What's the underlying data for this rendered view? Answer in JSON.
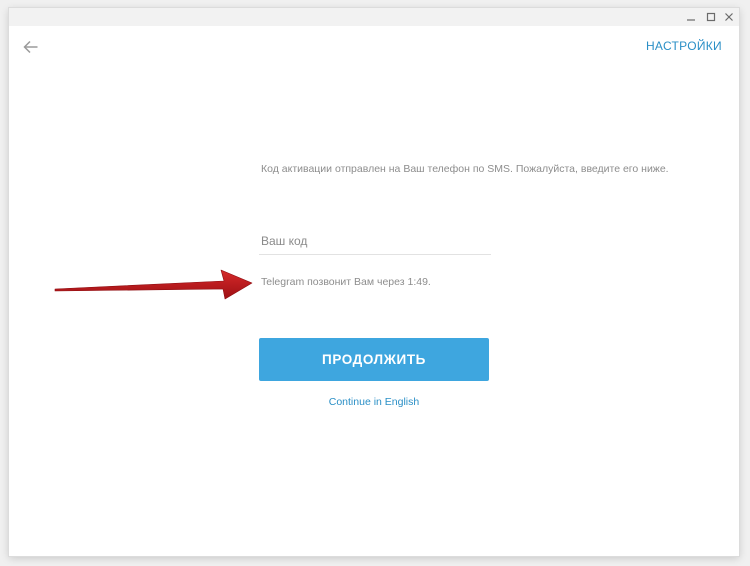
{
  "window": {
    "controls": [
      "minimize-icon",
      "maximize-icon",
      "close-icon"
    ]
  },
  "header": {
    "back_icon": "arrow-left-icon",
    "settings_label": "НАСТРОЙКИ"
  },
  "main": {
    "instruction": "Код активации отправлен на Ваш телефон по SMS. Пожалуйста, введите его ниже.",
    "code_input": {
      "placeholder": "Ваш код",
      "value": ""
    },
    "call_timer": "Telegram позвонит Вам через 1:49.",
    "continue_label": "ПРОДОЛЖИТЬ",
    "english_link": "Continue in English"
  },
  "colors": {
    "accent": "#3ea6df",
    "link": "#2a8fc6",
    "annotation_arrow": "#c1151b"
  }
}
